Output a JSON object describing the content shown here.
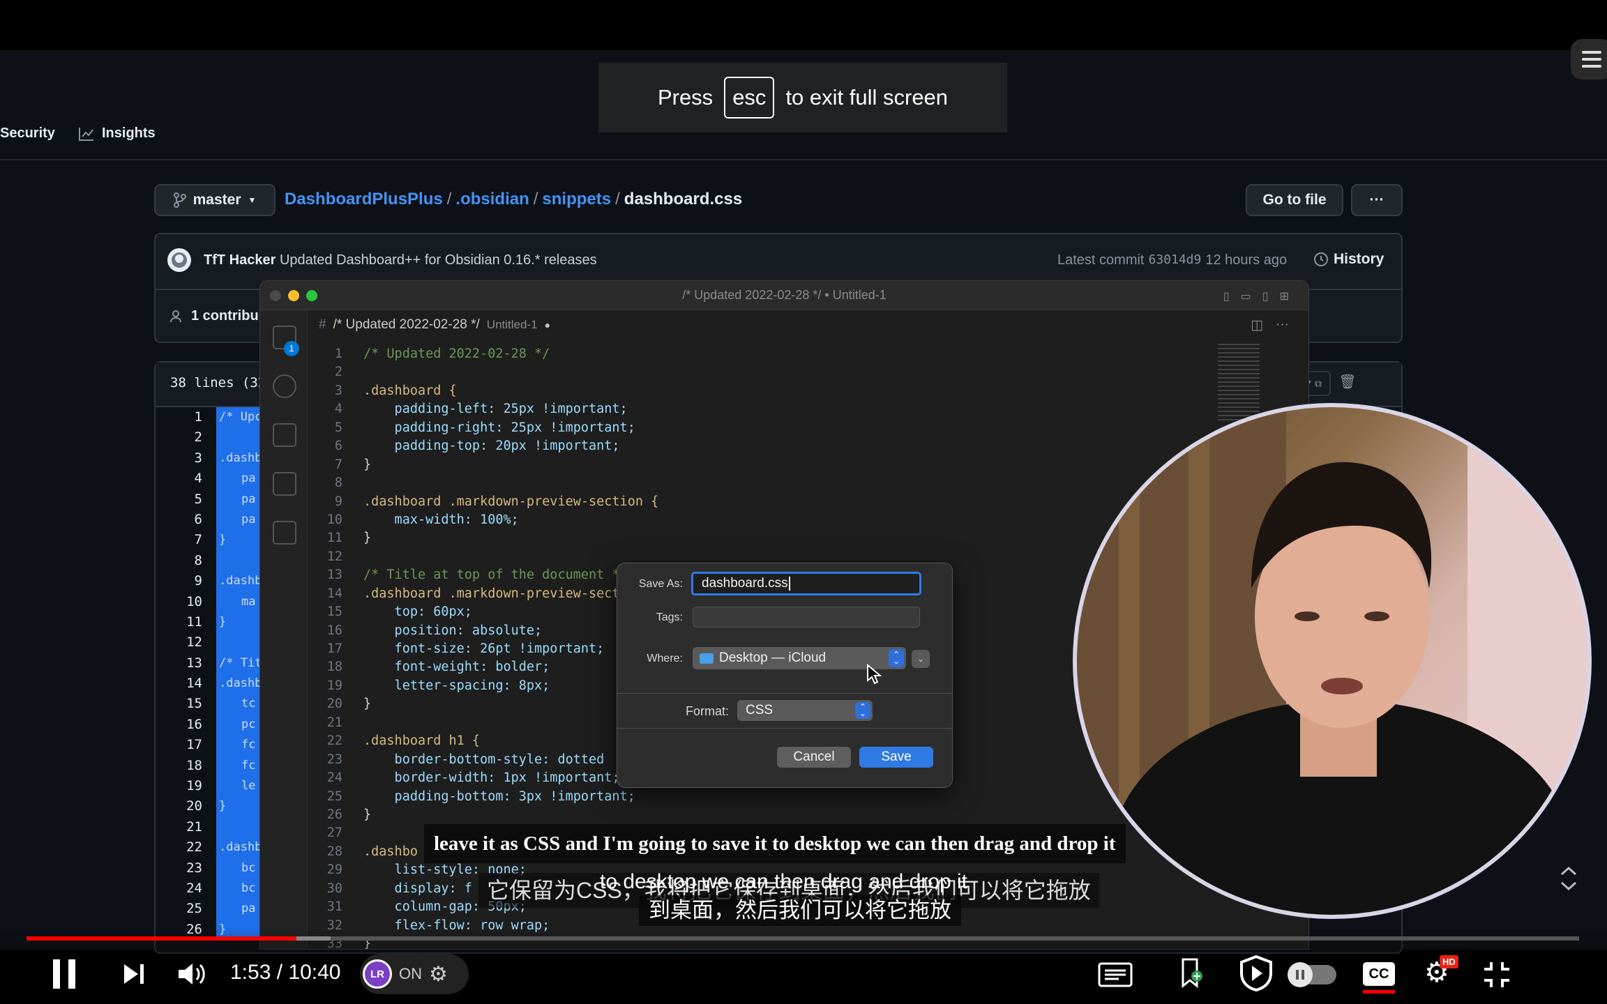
{
  "esc_overlay": {
    "press": "Press",
    "key": "esc",
    "rest": "to exit full screen"
  },
  "github": {
    "nav": {
      "security": "Security",
      "insights": "Insights"
    },
    "branch": "master",
    "breadcrumb": {
      "repo": "DashboardPlusPlus",
      "dir1": ".obsidian",
      "dir2": "snippets",
      "file": "dashboard.css"
    },
    "go_to_file": "Go to file",
    "more": "···",
    "commit": {
      "author": "TfT Hacker",
      "message": "Updated Dashboard++ for Obsidian 0.16.* releases",
      "latest": "Latest commit",
      "sha": "63014d9",
      "time": "12 hours ago",
      "history": "History"
    },
    "contributors": "1 contribu",
    "lines_info": "38 lines (32",
    "line_numbers": [
      "1",
      "2",
      "3",
      "4",
      "5",
      "6",
      "7",
      "8",
      "9",
      "10",
      "11",
      "12",
      "13",
      "14",
      "15",
      "16",
      "17",
      "18",
      "19",
      "20",
      "21",
      "22",
      "23",
      "24",
      "25",
      "26"
    ],
    "code_snips": [
      "/* Upc",
      "",
      ".dashb",
      "pa",
      "pa",
      "pa",
      "}",
      "",
      ".dashb",
      "ma",
      "}",
      "",
      "/* Tit",
      ".dashb",
      "tc",
      "pc",
      "fc",
      "fc",
      "le",
      "}",
      "",
      ".dashb",
      "bc",
      "bc",
      "pa",
      "}"
    ]
  },
  "vscode": {
    "window_title": "/* Updated 2022-02-28 */ • Untitled-1",
    "tab": {
      "hash": "#",
      "title": "/* Updated 2022-02-28 */",
      "file": "Untitled-1",
      "dot": "●"
    },
    "badge": "1",
    "lines": [
      {
        "n": "1",
        "t": "/* Updated 2022-02-28 */",
        "k": "cm"
      },
      {
        "n": "2",
        "t": "",
        "k": "br"
      },
      {
        "n": "3",
        "t": ".dashboard {",
        "k": "sel"
      },
      {
        "n": "4",
        "t": "    padding-left: 25px !important;",
        "k": "pr"
      },
      {
        "n": "5",
        "t": "    padding-right: 25px !important;",
        "k": "pr"
      },
      {
        "n": "6",
        "t": "    padding-top: 20px !important;",
        "k": "pr"
      },
      {
        "n": "7",
        "t": "}",
        "k": "br"
      },
      {
        "n": "8",
        "t": "",
        "k": "br"
      },
      {
        "n": "9",
        "t": ".dashboard .markdown-preview-section {",
        "k": "sel"
      },
      {
        "n": "10",
        "t": "    max-width: 100%;",
        "k": "pr"
      },
      {
        "n": "11",
        "t": "}",
        "k": "br"
      },
      {
        "n": "12",
        "t": "",
        "k": "br"
      },
      {
        "n": "13",
        "t": "/* Title at top of the document *",
        "k": "cm"
      },
      {
        "n": "14",
        "t": ".dashboard .markdown-preview-sect",
        "k": "sel"
      },
      {
        "n": "15",
        "t": "    top: 60px;",
        "k": "pr"
      },
      {
        "n": "16",
        "t": "    position: absolute;",
        "k": "pr"
      },
      {
        "n": "17",
        "t": "    font-size: 26pt !important;",
        "k": "pr"
      },
      {
        "n": "18",
        "t": "    font-weight: bolder;",
        "k": "pr"
      },
      {
        "n": "19",
        "t": "    letter-spacing: 8px;",
        "k": "pr"
      },
      {
        "n": "20",
        "t": "}",
        "k": "br"
      },
      {
        "n": "21",
        "t": "",
        "k": "br"
      },
      {
        "n": "22",
        "t": ".dashboard h1 {",
        "k": "sel"
      },
      {
        "n": "23",
        "t": "    border-bottom-style: dotted",
        "k": "pr"
      },
      {
        "n": "24",
        "t": "    border-width: 1px !important;",
        "k": "pr"
      },
      {
        "n": "25",
        "t": "    padding-bottom: 3px !important;",
        "k": "pr"
      },
      {
        "n": "26",
        "t": "}",
        "k": "br"
      },
      {
        "n": "27",
        "t": "",
        "k": "br"
      },
      {
        "n": "28",
        "t": ".dashbo",
        "k": "sel"
      },
      {
        "n": "29",
        "t": "    list-style: none;",
        "k": "pr"
      },
      {
        "n": "30",
        "t": "    display: f",
        "k": "pr"
      },
      {
        "n": "31",
        "t": "    column-gap: 50px;",
        "k": "pr"
      },
      {
        "n": "32",
        "t": "    flex-flow: row wrap;",
        "k": "pr"
      },
      {
        "n": "33",
        "t": "}",
        "k": "br"
      }
    ]
  },
  "save_dialog": {
    "save_as_label": "Save As:",
    "save_as_value": "dashboard.css",
    "tags_label": "Tags:",
    "tags_value": "",
    "where_label": "Where:",
    "where_value": "Desktop — iCloud",
    "format_label": "Format:",
    "format_value": "CSS",
    "cancel": "Cancel",
    "save": "Save"
  },
  "subtitles": {
    "english": "leave it as CSS and I'm going to save it to desktop we can then drag and drop it",
    "chinese_faded": "它保留为CSS，我将把它保存到桌面，然后我们可以将它拖放",
    "english2": "to desktop we can then drag and drop it",
    "chinese": "到桌面，然后我们可以将它拖放"
  },
  "player": {
    "time": "1:53 / 10:40",
    "lr_label": "LR",
    "lr_state": "ON",
    "hd": "HD",
    "progress_played": 0.174,
    "progress_buffered": 0.196,
    "colors": {
      "played": "#ff0000",
      "buffered": "#888888",
      "track": "#555555"
    }
  }
}
